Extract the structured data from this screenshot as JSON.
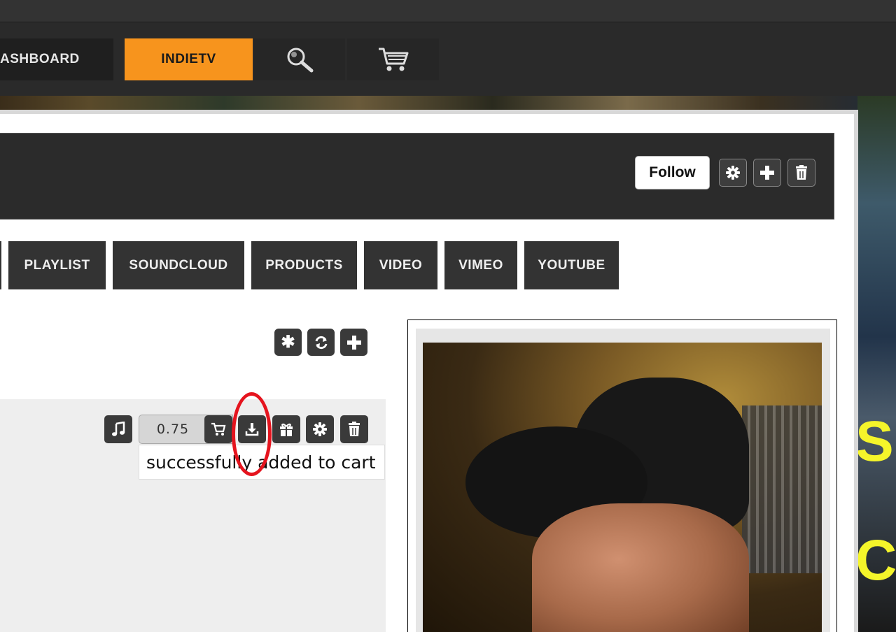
{
  "nav": {
    "dashboard_label": "ASHBOARD",
    "indietv_label": "INDIETV",
    "search_icon": "magnifier-icon",
    "cart_icon": "shopping-cart-icon",
    "accent_color": "#f7941d"
  },
  "profile_header": {
    "follow_label": "Follow",
    "icons": [
      "gear-icon",
      "plus-icon",
      "trash-icon"
    ]
  },
  "tabs": [
    {
      "label": "PLAYLIST"
    },
    {
      "label": "SOUNDCLOUD"
    },
    {
      "label": "PRODUCTS"
    },
    {
      "label": "VIDEO"
    },
    {
      "label": "VIMEO"
    },
    {
      "label": "YOUTUBE"
    }
  ],
  "list_toolbar": {
    "icons": [
      "asterisk-icon",
      "refresh-icon",
      "plus-icon"
    ]
  },
  "track": {
    "price": "0.75",
    "icons": [
      "music-note-icon",
      "cart-icon",
      "download-icon",
      "gift-icon",
      "gear-icon",
      "trash-icon"
    ],
    "tooltip": "successfully added to cart",
    "annotation_color": "#e5141e"
  },
  "background": {
    "poster_text_1": "S",
    "poster_text_2": "C"
  }
}
